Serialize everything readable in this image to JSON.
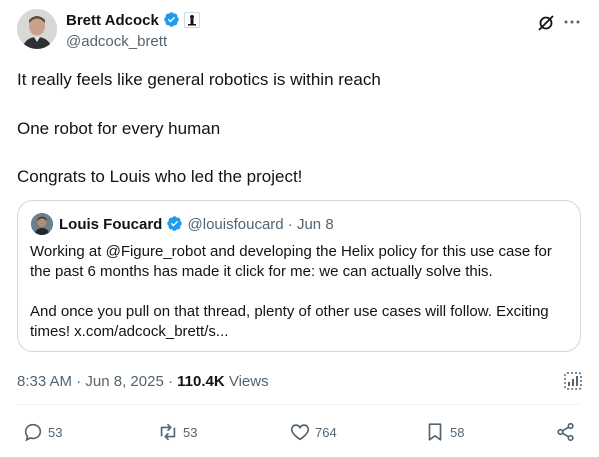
{
  "author": {
    "name": "Brett Adcock",
    "handle": "@adcock_brett"
  },
  "post": {
    "lines": [
      "It really feels like general robotics is within reach",
      "One robot for every human",
      "Congrats to Louis who led the project!"
    ]
  },
  "quote": {
    "name": "Louis Foucard",
    "handle": "@louisfoucard",
    "separator": "·",
    "date": "Jun 8",
    "lines": [
      "Working at @Figure_robot and developing the Helix policy for this use case for",
      "the past 6 months has made it click for me: we can actually solve this.",
      "And once you pull on that thread, plenty of other use cases will follow. Exciting",
      "times! x.com/adcock_brett/s..."
    ]
  },
  "meta": {
    "time": "8:33 AM",
    "separator": "·",
    "date": "Jun 8, 2025",
    "views_count": "110.4K",
    "views_label": "Views"
  },
  "actions": {
    "replies": "53",
    "reposts": "53",
    "likes": "764",
    "bookmarks": "58"
  },
  "colors": {
    "text": "#0f1419",
    "secondary": "#536471",
    "verified": "#1d9bf0",
    "border": "#cfd9de"
  },
  "icons": [
    "verified-badge-icon",
    "affiliate-badge-icon",
    "grok-icon",
    "more-icon",
    "analytics-icon",
    "reply-icon",
    "repost-icon",
    "like-icon",
    "bookmark-icon",
    "share-icon"
  ]
}
